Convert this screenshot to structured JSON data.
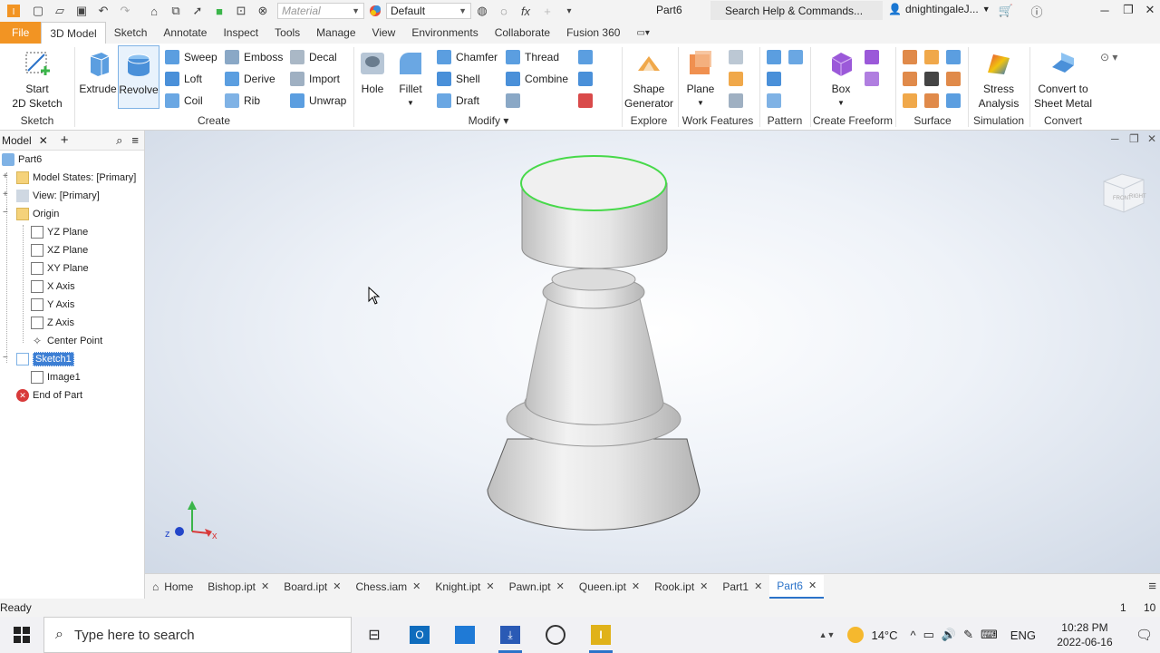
{
  "qat": {
    "material_placeholder": "Material",
    "appearance_value": "Default",
    "doc_title": "Part6",
    "search_placeholder": "Search Help & Commands...",
    "user_name": "dnightingaleJ..."
  },
  "tabs": [
    "File",
    "3D Model",
    "Sketch",
    "Annotate",
    "Inspect",
    "Tools",
    "Manage",
    "View",
    "Environments",
    "Collaborate",
    "Fusion 360"
  ],
  "ribbon": {
    "sketch": {
      "start": "Start",
      "sketch2d": "2D Sketch",
      "panel": "Sketch"
    },
    "create": {
      "extrude": "Extrude",
      "revolve": "Revolve",
      "sweep": "Sweep",
      "loft": "Loft",
      "coil": "Coil",
      "emboss": "Emboss",
      "derive": "Derive",
      "rib": "Rib",
      "decal": "Decal",
      "import": "Import",
      "unwrap": "Unwrap",
      "panel": "Create"
    },
    "modify": {
      "hole": "Hole",
      "fillet": "Fillet",
      "chamfer": "Chamfer",
      "shell": "Shell",
      "draft": "Draft",
      "thread": "Thread",
      "combine": "Combine",
      "panel": "Modify"
    },
    "explore": {
      "shape": "Shape",
      "generator": "Generator",
      "panel": "Explore"
    },
    "work": {
      "plane": "Plane",
      "panel": "Work Features"
    },
    "pattern": {
      "panel": "Pattern"
    },
    "freeform": {
      "box": "Box",
      "panel": "Create Freeform"
    },
    "surface": {
      "panel": "Surface"
    },
    "simulation": {
      "stress": "Stress",
      "analysis": "Analysis",
      "panel": "Simulation"
    },
    "convert": {
      "convert_to": "Convert to",
      "sheet_metal": "Sheet Metal",
      "panel": "Convert"
    }
  },
  "browser": {
    "title": "Model",
    "nodes": [
      "Part6",
      "Model States: [Primary]",
      "View: [Primary]",
      "Origin",
      "YZ Plane",
      "XZ Plane",
      "XY Plane",
      "X Axis",
      "Y Axis",
      "Z Axis",
      "Center Point",
      "Sketch1",
      "Image1",
      "End of Part"
    ]
  },
  "viewcube": {
    "front": "FRONT",
    "right": "RIGHT"
  },
  "triad": {
    "x": "x",
    "z": "z"
  },
  "doctabs": {
    "home": "Home",
    "files": [
      "Bishop.ipt",
      "Board.ipt",
      "Chess.iam",
      "Knight.ipt",
      "Pawn.ipt",
      "Queen.ipt",
      "Rook.ipt",
      "Part1",
      "Part6"
    ],
    "active_index": 8
  },
  "status": {
    "text": "Ready",
    "count_a": "1",
    "count_b": "10"
  },
  "taskbar": {
    "search_placeholder": "Type here to search",
    "temperature": "14°C",
    "lang": "ENG",
    "time": "10:28 PM",
    "date": "2022-06-16"
  },
  "colors": {
    "accent": "#2b73c9",
    "file_tab": "#f29423",
    "selection_edge": "#47d94a",
    "x_axis": "#d83a3a",
    "y_axis": "#3bb54a",
    "z_axis": "#2346c9"
  }
}
